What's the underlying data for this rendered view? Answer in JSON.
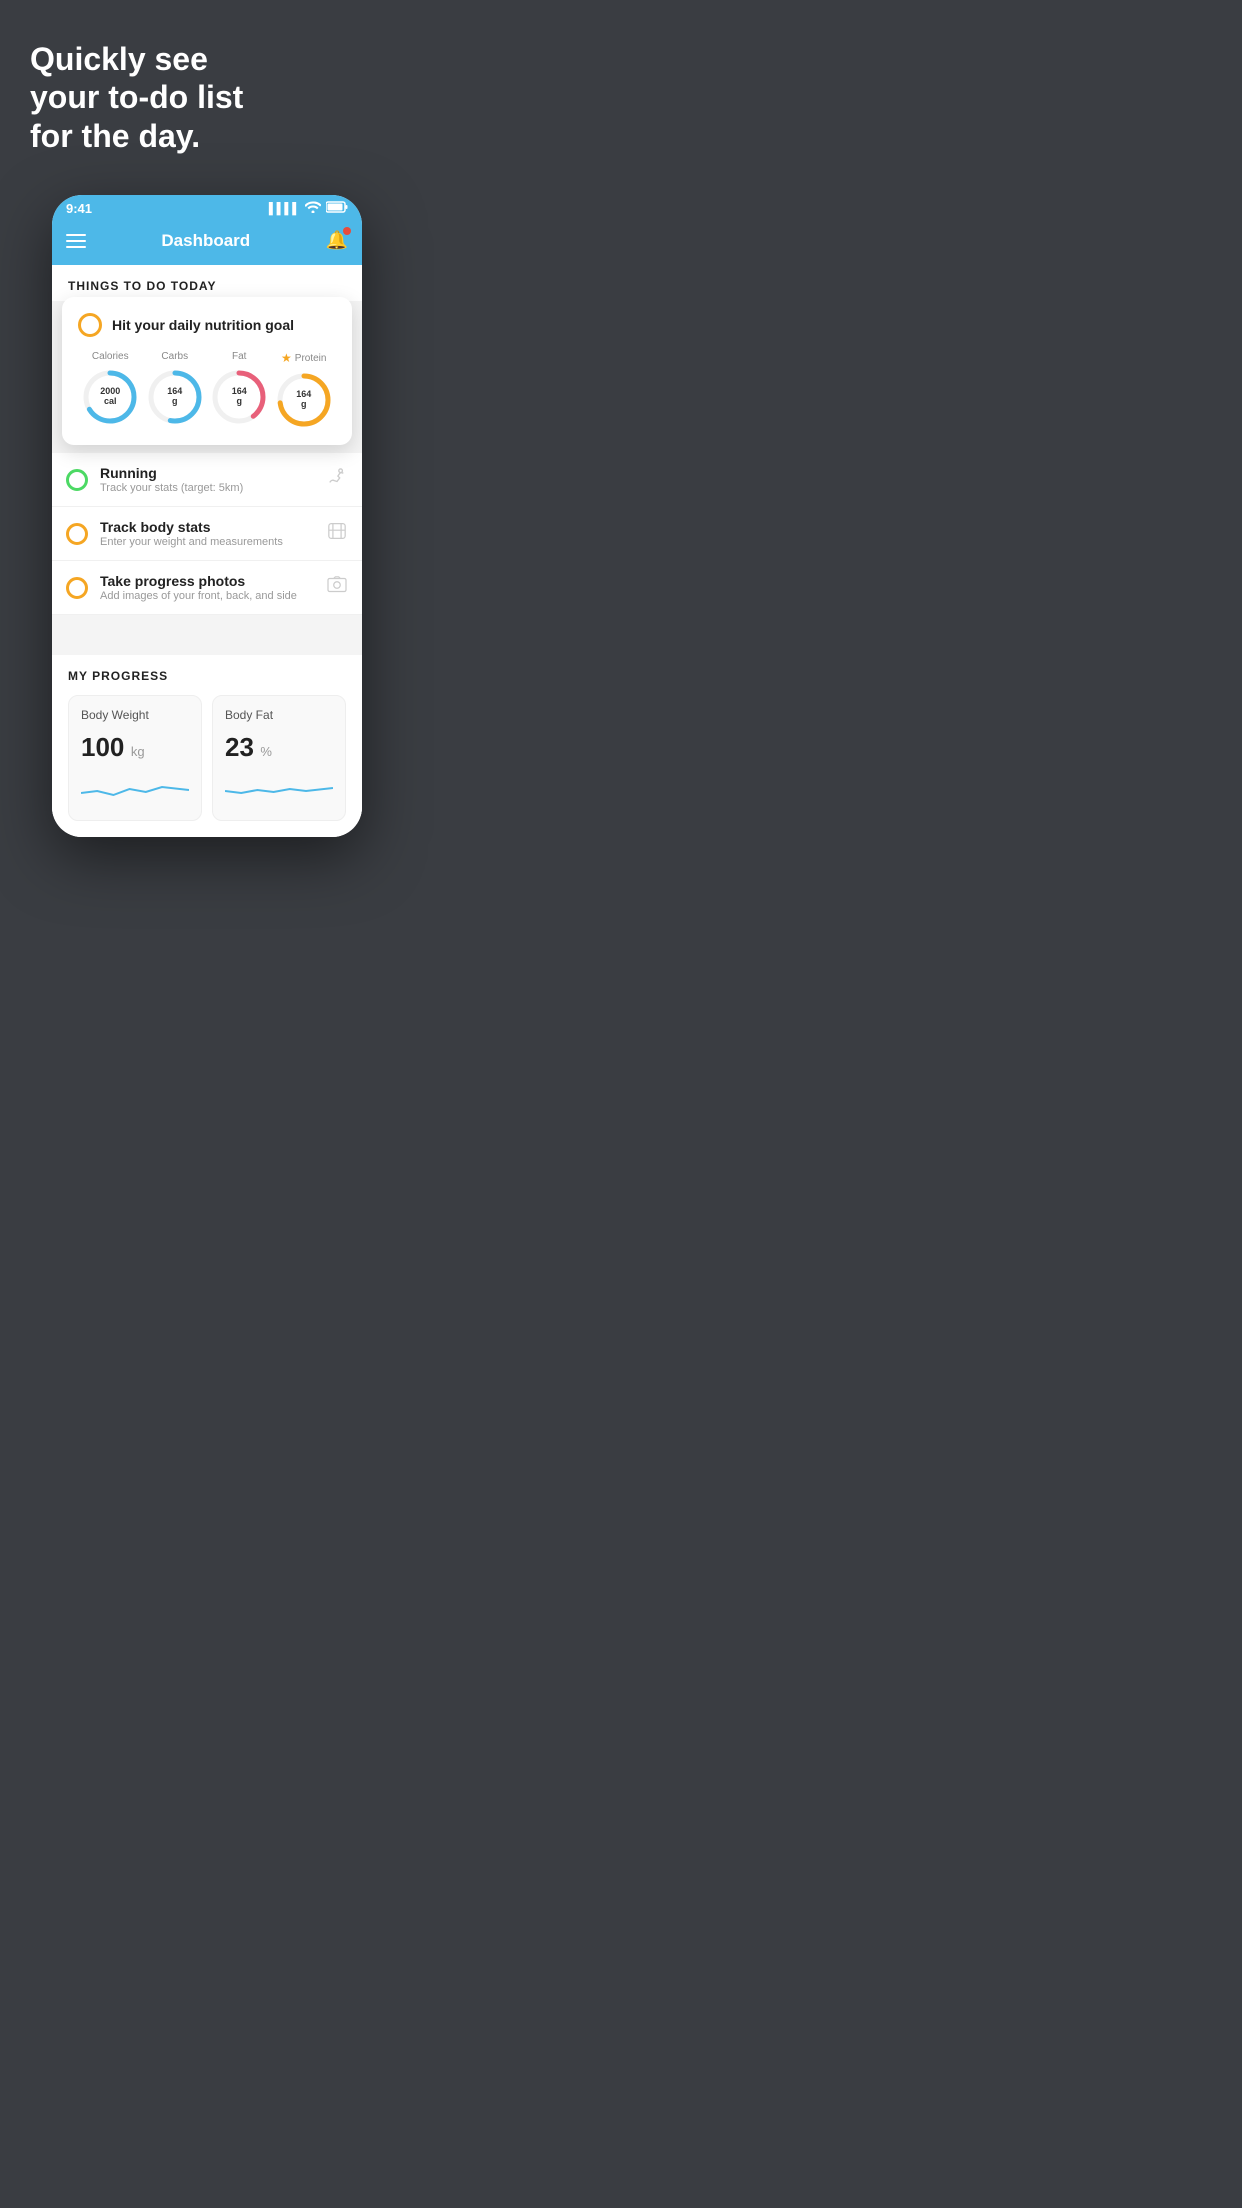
{
  "hero": {
    "line1": "Quickly see",
    "line2": "your to-do list",
    "line3": "for the day."
  },
  "status_bar": {
    "time": "9:41",
    "signal": "▌▌▌▌",
    "wifi": "wifi",
    "battery": "battery"
  },
  "nav": {
    "title": "Dashboard"
  },
  "things_today": {
    "header": "THINGS TO DO TODAY"
  },
  "nutrition_card": {
    "title": "Hit your daily nutrition goal",
    "calories_label": "Calories",
    "carbs_label": "Carbs",
    "fat_label": "Fat",
    "protein_label": "Protein",
    "calories_value": "2000",
    "calories_unit": "cal",
    "carbs_value": "164",
    "carbs_unit": "g",
    "fat_value": "164",
    "fat_unit": "g",
    "protein_value": "164",
    "protein_unit": "g"
  },
  "todo_items": [
    {
      "title": "Running",
      "subtitle": "Track your stats (target: 5km)",
      "circle_color": "green",
      "icon": "👟"
    },
    {
      "title": "Track body stats",
      "subtitle": "Enter your weight and measurements",
      "circle_color": "yellow",
      "icon": "⚖"
    },
    {
      "title": "Take progress photos",
      "subtitle": "Add images of your front, back, and side",
      "circle_color": "yellow",
      "icon": "🖼"
    }
  ],
  "progress": {
    "header": "MY PROGRESS",
    "cards": [
      {
        "title": "Body Weight",
        "value": "100",
        "unit": "kg"
      },
      {
        "title": "Body Fat",
        "value": "23",
        "unit": "%"
      }
    ]
  }
}
